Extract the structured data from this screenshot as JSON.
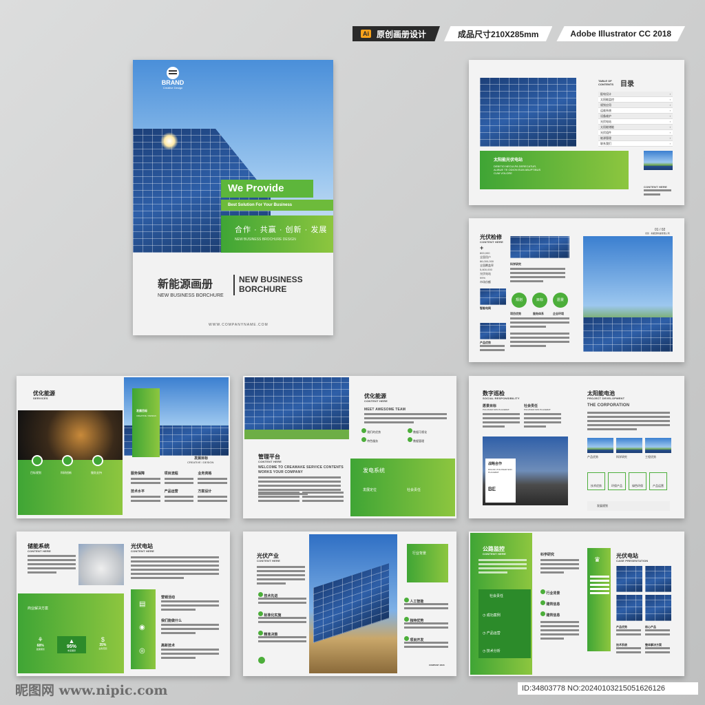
{
  "tags": {
    "ai_badge": "Ai",
    "original": "原创画册设计",
    "size": "成品尺寸210X285mm",
    "software": "Adobe Illustrator CC 2018"
  },
  "cover": {
    "brand": "BRAND",
    "brand_sub": "Creative Design",
    "we_provide": "We Provide",
    "tagline": "Best Solution For Your Business",
    "values_cn": "合作 · 共赢 · 创新 · 发展",
    "values_en": "NEW BUSINESS  BROCHURE DESIGN",
    "title_cn": "新能源画册",
    "title_en_small": "NEW BUSINESS  BORCHURE",
    "title_en_big1": "NEW BUSINESS",
    "title_en_big2": "BORCHURE",
    "website": "WWW.COMPANYNAME.COM"
  },
  "spread_toc": {
    "toc_label1": "TABLE OF",
    "toc_label2": "CONTENTS",
    "toc_title": "目录",
    "items": [
      "配电设计",
      "太阳能监控",
      "规划应用",
      "运维系统",
      "设备维护",
      "光伏电站",
      "太阳能储能",
      "光伏组件",
      "能源管理",
      "联系我们"
    ],
    "green_title": "太阳能光伏电站",
    "green_text1": "DEBITIO NECULPA DERECATUR,",
    "green_text2": "ALIBUE TE ODION EUM ABUPTIBUS",
    "green_text3": "CUM VOLORE",
    "content_here": "CONTENT HERE"
  },
  "spread_pv": {
    "title": "光伏检修",
    "sub": "CONTENT HERE",
    "plus": "+",
    "stats": [
      "800,000",
      "全国用户",
      "86,000,000",
      "全国覆盖率",
      "5,800,000",
      "光伏电站",
      "99%",
      "市场份额"
    ],
    "col2_label": "科学研究",
    "c1": "规划",
    "c2": "目标",
    "c3": "愿景",
    "cl1": "项目优势",
    "cl2": "服务体系",
    "cl3": "企业环境",
    "left_a": "智能电网",
    "left_b": "产品优势",
    "page_no": "01 / 02",
    "page_sub": "光伏 · 新能源科技有限公司"
  },
  "spread_opt": {
    "title": "优化能源",
    "sub": "SERVICES",
    "i1": "目标规划",
    "i2": "科研创新",
    "i3": "服务支持",
    "card_label": "发展目标",
    "card_sub": "CREATIVE / DESIGN",
    "right_title": "发展目标",
    "right_sub": "CREATIVE / DESIGN",
    "g1": "服务保障",
    "g2": "项目流程",
    "g3": "业务资格",
    "g4": "技术水平",
    "g5": "产品运营",
    "g6": "方案设计"
  },
  "spread_mgmt": {
    "title": "优化能源",
    "sub": "CONTENT HERE",
    "team": "MEET AWESOME TEAM",
    "b1": "我们的优势",
    "b2": "数据可视化",
    "b3": "特色服务",
    "b4": "数据管理",
    "left_title": "管理平台",
    "left_sub": "CONTENT HERE",
    "welcome1": "WELCOME TO CREAMAKE SERVICE CONTENTS",
    "welcome2": "WORKS YOUR COMPANY",
    "green_title": "发电系统",
    "gl1": "发展定位",
    "gl2": "社会责任"
  },
  "spread_social": {
    "title": "数字巡检",
    "sub": "SOCIAL RESPONSIBILITY",
    "a1": "愿景目标",
    "a2": "社会责任",
    "a_sub": "PULVINAR NON PLACERAT.",
    "card_title": "战略合作",
    "card_t1": "DOLOR, PULVINAR NON",
    "card_t2": "PLACERAT.",
    "be": "BE",
    "right_title": "太阳能电池",
    "right_sub": "PROJECT DEVELOPMENT",
    "corp": "THE CORPORATION",
    "p1": "产品优势",
    "p2": "科学研究",
    "p3": "工程优势",
    "ic1": "技术优势",
    "ic2": "环保产品",
    "ic3": "绿色环保",
    "ic4": "产品运营",
    "foot": "发展规划"
  },
  "spread_storage": {
    "title": "储能系统",
    "sub": "CONTENT HERE",
    "green_label": "商业解决方案",
    "s1_val": "68%",
    "s1_lbl": "发展规划",
    "s2_val": "95%",
    "s2_lbl": "未来展望",
    "s3_val": "35%",
    "s3_lbl": "业务范围",
    "right_title": "光伏电站",
    "right_sub": "CONTENT HERE",
    "r1": "营销活动",
    "r2": "我们能做什么",
    "r3": "高新技术"
  },
  "spread_industry": {
    "title": "光伏产业",
    "sub": "CONTENT HERE",
    "l1": "技术先进",
    "l2": "标准化实施",
    "l3": "精准决策",
    "green_label": "行业背景",
    "r1": "人工智能",
    "r2": "独特优势",
    "r3": "项目开发",
    "foot": "COMPANY 2023"
  },
  "spread_road": {
    "title": "公路监控",
    "sub": "CONTENT HERE",
    "mid_label": "科学研究",
    "soc": "社会责任",
    "b1": "成功案例",
    "b2": "产品运营",
    "b3": "技术分析",
    "m1": "行业背景",
    "m2": "建筑信息",
    "m3": "建筑信息",
    "right_title": "光伏电站",
    "right_sub": "CASE PRESENTATION",
    "rp1": "产品优势",
    "rp2": "核心产品",
    "rp3": "技术系统",
    "rp4": "整体解决方案"
  },
  "watermark": {
    "left": "昵图网 www.nipic.com",
    "right": "ID:34803778 NO:20240103215051626126"
  }
}
